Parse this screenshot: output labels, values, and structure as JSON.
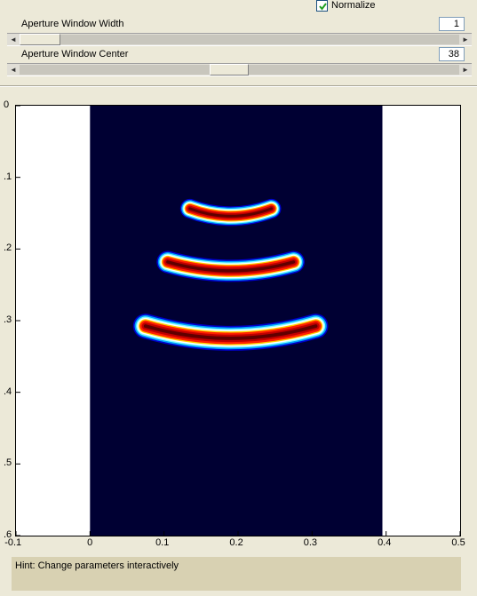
{
  "normalize": {
    "label": "Normalize",
    "checked": true
  },
  "aperture_width": {
    "label": "Aperture Window Width",
    "value": "1",
    "slider_fraction": 0.0
  },
  "aperture_center": {
    "label": "Aperture Window Center",
    "value": "38",
    "slider_fraction": 0.42
  },
  "icons": {
    "checkbox": "check-icon",
    "left": "arrow-left-icon",
    "right": "arrow-right-icon"
  },
  "colors": {
    "background": "#ece9d8",
    "image_bg": "#000033",
    "hint_bg": "#d8d1b2"
  },
  "chart_data": {
    "type": "heatmap",
    "title": "",
    "xlabel": "",
    "ylabel": "",
    "xlim": [
      -0.1,
      0.5
    ],
    "ylim": [
      0.6,
      0
    ],
    "x_ticks": [
      "-0.1",
      "0",
      "0.1",
      "0.2",
      "0.3",
      "0.4",
      "0.5"
    ],
    "y_ticks": [
      "0",
      ".1",
      ".2",
      ".3",
      ".4",
      ".5",
      ".6"
    ],
    "image_extent_x": [
      0.0,
      0.395
    ],
    "arcs": [
      {
        "x_center": 0.19,
        "y_center": 0.147,
        "half_width": 0.055,
        "sag": 0.011
      },
      {
        "x_center": 0.19,
        "y_center": 0.222,
        "half_width": 0.085,
        "sag": 0.013
      },
      {
        "x_center": 0.19,
        "y_center": 0.313,
        "half_width": 0.115,
        "sag": 0.018
      }
    ],
    "colormap": "jet"
  },
  "hint": "Hint: Change parameters interactively"
}
